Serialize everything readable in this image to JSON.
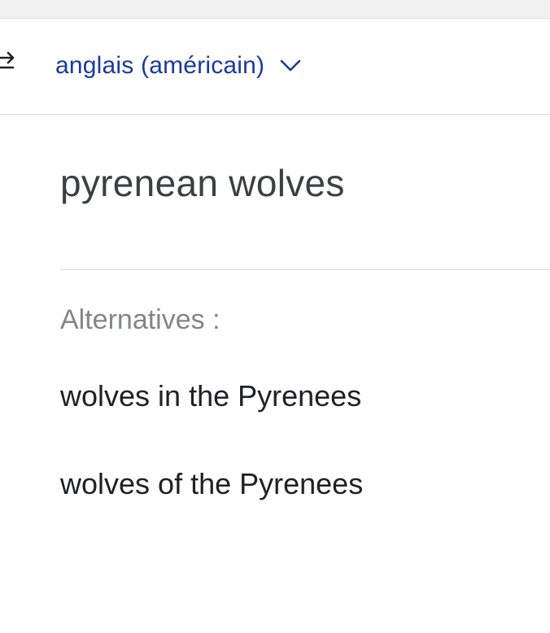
{
  "header": {
    "target_language": "anglais (américain)",
    "swap_icon": "swap-arrows-icon",
    "dropdown_icon": "chevron-down-icon"
  },
  "result": {
    "translation": "pyrenean wolves"
  },
  "alternatives": {
    "title": "Alternatives :",
    "items": [
      "wolves in the Pyrenees",
      "wolves of the Pyrenees"
    ]
  },
  "colors": {
    "accent": "#1a3a9e",
    "text_primary": "#202124",
    "text_secondary": "#80868b",
    "divider": "#dadce0"
  }
}
